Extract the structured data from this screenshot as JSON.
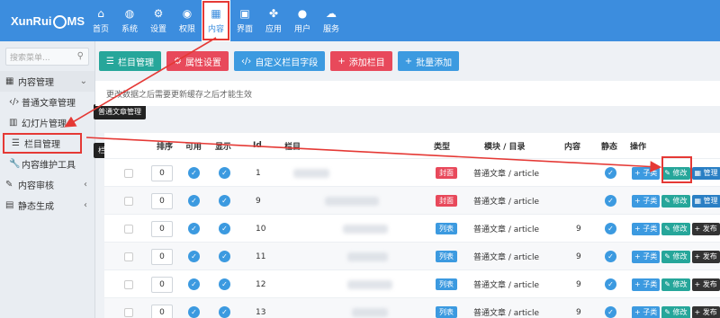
{
  "logo": {
    "pre": "XunRui",
    "post": "MS"
  },
  "topnav": [
    {
      "label": "首页",
      "icon": "home-icon",
      "glyph": "⌂"
    },
    {
      "label": "系统",
      "icon": "globe-icon",
      "glyph": "◍"
    },
    {
      "label": "设置",
      "icon": "cogs-icon",
      "glyph": "⚙"
    },
    {
      "label": "权限",
      "icon": "user-circle-icon",
      "glyph": "◉"
    },
    {
      "label": "内容",
      "icon": "grid-icon",
      "glyph": "▦"
    },
    {
      "label": "界面",
      "icon": "html5-icon",
      "glyph": "▣"
    },
    {
      "label": "应用",
      "icon": "puzzle-icon",
      "glyph": "✤"
    },
    {
      "label": "用户",
      "icon": "user-icon",
      "glyph": "●"
    },
    {
      "label": "服务",
      "icon": "cloud-icon",
      "glyph": "☁"
    }
  ],
  "sidebar": {
    "search_placeholder": "搜索菜单...",
    "items": [
      {
        "label": "内容管理",
        "glyph": "▦",
        "icon": "grid-icon"
      },
      {
        "label": "普通文章管理",
        "glyph": "‹/›",
        "icon": "code-icon"
      },
      {
        "label": "幻灯片管理",
        "glyph": "▥",
        "icon": "slides-icon"
      },
      {
        "label": "栏目管理",
        "glyph": "☰",
        "icon": "list-icon"
      },
      {
        "label": "内容维护工具",
        "glyph": "🔧",
        "icon": "wrench-icon"
      },
      {
        "label": "内容审核",
        "glyph": "✎",
        "icon": "edit-icon"
      },
      {
        "label": "静态生成",
        "glyph": "▤",
        "icon": "file-icon"
      }
    ],
    "tooltip_article": "普通文章管理",
    "tooltip_column": "栏目管理"
  },
  "toolbar": {
    "buttons": [
      {
        "label": "栏目管理",
        "glyph": "☰",
        "icon": "list-icon",
        "color": "green"
      },
      {
        "label": "属性设置",
        "glyph": "⚙",
        "icon": "cog-icon",
        "color": "red"
      },
      {
        "label": "自定义栏目字段",
        "glyph": "‹/›",
        "icon": "code-icon",
        "color": "blue"
      },
      {
        "label": "添加栏目",
        "glyph": "+",
        "icon": "plus-icon",
        "color": "red"
      },
      {
        "label": "批量添加",
        "glyph": "+",
        "icon": "plus-icon",
        "color": "blue"
      }
    ]
  },
  "notice": "更改数据之后需要更新缓存之后才能生效",
  "table": {
    "headers": {
      "sort": "排序",
      "usable": "可用",
      "show": "显示",
      "id": "Id",
      "name": "栏目",
      "type": "类型",
      "module": "模块 / 目录",
      "content": "内容",
      "static": "静态",
      "ops": "操作"
    },
    "rows": [
      {
        "sort": "0",
        "id": "1",
        "type": "封面",
        "typeColor": "red",
        "module": "普通文章 / article",
        "content": "",
        "static": true
      },
      {
        "sort": "0",
        "id": "9",
        "type": "封面",
        "typeColor": "red",
        "module": "普通文章 / article",
        "content": "",
        "static": true
      },
      {
        "sort": "0",
        "id": "10",
        "type": "列表",
        "typeColor": "blue",
        "module": "普通文章 / article",
        "content": "9",
        "static": true
      },
      {
        "sort": "0",
        "id": "11",
        "type": "列表",
        "typeColor": "blue",
        "module": "普通文章 / article",
        "content": "9",
        "static": true
      },
      {
        "sort": "0",
        "id": "12",
        "type": "列表",
        "typeColor": "blue",
        "module": "普通文章 / article",
        "content": "9",
        "static": true
      },
      {
        "sort": "0",
        "id": "13",
        "type": "列表",
        "typeColor": "blue",
        "module": "普通文章 / article",
        "content": "9",
        "static": true
      }
    ],
    "actions": {
      "sub": "+ 子类",
      "edit": "✎ 修改",
      "manage": "▦ 管理",
      "publish": "+ 发布"
    }
  }
}
